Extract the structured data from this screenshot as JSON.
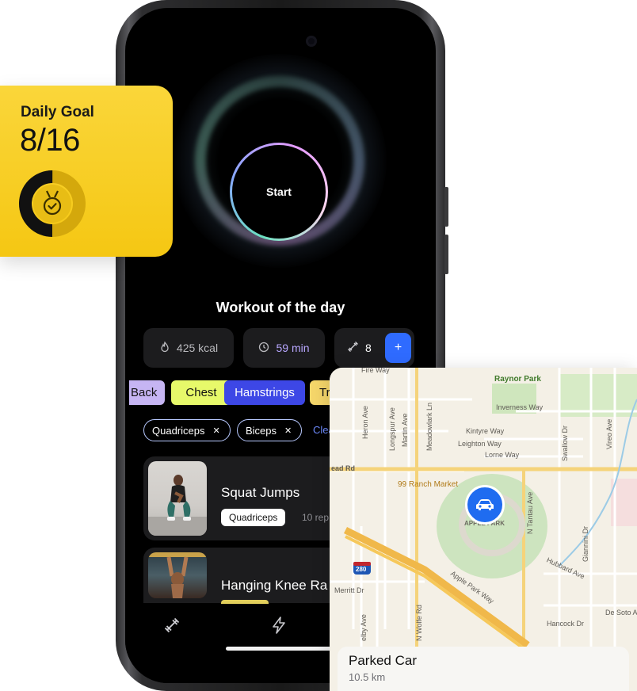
{
  "goal": {
    "title": "Daily Goal",
    "value": "8/16",
    "progress": 0.5,
    "icon": "medal-icon",
    "accent": "#f5c713"
  },
  "workout": {
    "start_label": "Start",
    "title": "Workout of the day",
    "stats": {
      "kcal": "425 kcal",
      "time": "59 min",
      "reps": "8",
      "add": "+"
    },
    "categories": [
      "Back",
      "Chest",
      "Hamstrings",
      "Tri"
    ],
    "filters": [
      "Quadriceps",
      "Biceps"
    ],
    "clear_label": "Clea",
    "exercises": [
      {
        "name": "Squat Jumps",
        "tag": "Quadriceps",
        "reps": "10 rep"
      },
      {
        "name": "Hanging Knee Ra"
      }
    ],
    "tabs": [
      "dumbbell-icon",
      "bolt-icon"
    ]
  },
  "map": {
    "places": {
      "raynor_park": "Raynor Park",
      "ranch_market": "99 Ranch Market",
      "apple_park": "APPLE PARK",
      "highway": "280"
    },
    "streets": {
      "fire_way": "Fire Way",
      "inverness": "Inverness Way",
      "kintyre": "Kintyre Way",
      "leighton": "Leighton Way",
      "lorne": "Lorne Way",
      "homestead": "ead Rd",
      "heron": "Heron Ave",
      "longspur": "Longspur Ave",
      "martin": "Martin Ave",
      "meadowlark": "Meadowlark Ln",
      "swallow": "Swallow Dr",
      "vireo": "Vireo Ave",
      "tantau": "N Tantau Ave",
      "giannini": "Giannini Dr",
      "hubbard": "Hubbard Ave",
      "apple_park_way": "Apple Park Way",
      "merritt": "Merritt Dr",
      "wolfe": "N Wolfe Rd",
      "hancock": "Hancock Dr",
      "desoto": "De Soto Ave",
      "selby": "elby Ave"
    },
    "parked": {
      "title": "Parked Car",
      "distance": "10.5 km"
    }
  }
}
